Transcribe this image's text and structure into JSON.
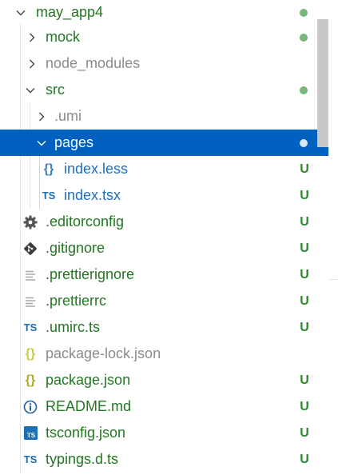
{
  "tree": {
    "root": {
      "label": "may_app4",
      "status": "modified-dot"
    },
    "items": [
      {
        "label": "mock",
        "status": "modified-dot"
      },
      {
        "label": "node_modules",
        "status": ""
      },
      {
        "label": "src",
        "status": "modified-dot"
      },
      {
        "label": ".umi",
        "status": ""
      },
      {
        "label": "pages",
        "status": "modified-dot"
      },
      {
        "label": "index.less",
        "status": "U"
      },
      {
        "label": "index.tsx",
        "status": "U"
      },
      {
        "label": ".editorconfig",
        "status": "U"
      },
      {
        "label": ".gitignore",
        "status": "U"
      },
      {
        "label": ".prettierignore",
        "status": "U"
      },
      {
        "label": ".prettierrc",
        "status": "U"
      },
      {
        "label": ".umirc.ts",
        "status": "U"
      },
      {
        "label": "package-lock.json",
        "status": ""
      },
      {
        "label": "package.json",
        "status": "U"
      },
      {
        "label": "README.md",
        "status": "U"
      },
      {
        "label": "tsconfig.json",
        "status": "U"
      },
      {
        "label": "typings.d.ts",
        "status": "U"
      }
    ]
  },
  "icons": {
    "css": "{}",
    "ts": "TS",
    "json": "{}"
  },
  "colors": {
    "selection": "#0060c0",
    "untracked": "#227722",
    "ignored": "#8b8b8b",
    "badge": "#2b8a2b"
  }
}
